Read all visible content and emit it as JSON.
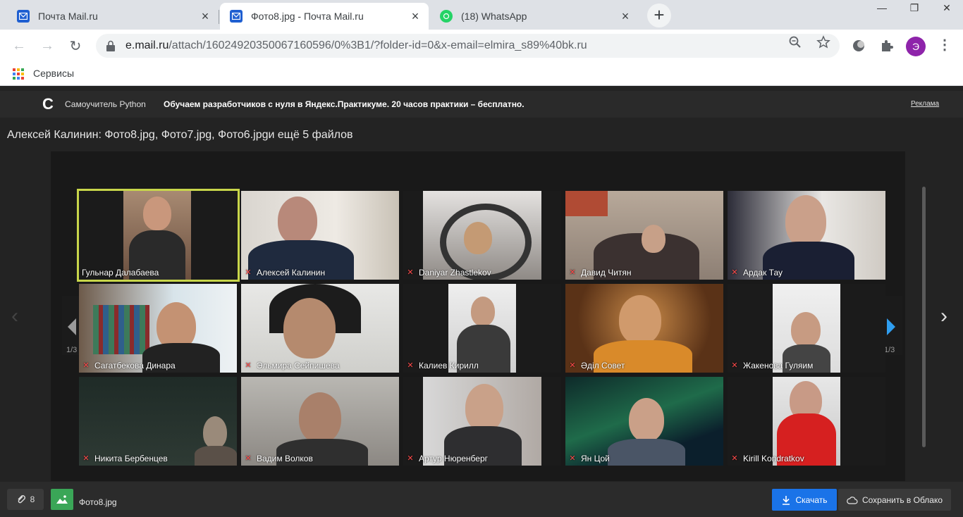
{
  "browser": {
    "tabs": [
      {
        "title": "Почта Mail.ru",
        "active": false
      },
      {
        "title": "Фото8.jpg - Почта Mail.ru",
        "active": true
      },
      {
        "title": "(18) WhatsApp",
        "active": false
      }
    ],
    "newtab_label": "+",
    "url_host": "e.mail.ru",
    "url_rest": "/attach/16024920350067160596/0%3B1/?folder-id=0&x-email=elmira_s89%40bk.ru",
    "profile_initial": "Э",
    "bookmarks_label": "Сервисы"
  },
  "ad": {
    "logo": "C",
    "title": "Самоучитель Python",
    "text": "Обучаем разработчиков с нуля в Яндекс.Практикуме. 20 часов практики – бесплатно.",
    "link": "Реклама"
  },
  "viewer": {
    "title": "Алексей Калинин: Фото8.jpg, Фото7.jpg, Фото6.jpgи ещё 5 файлов",
    "page_left": "1/3",
    "page_right": "1/3",
    "participants": [
      {
        "name": "Гульнар Далабаева",
        "muted": false,
        "speaker": true
      },
      {
        "name": "Алексей Калинин",
        "muted": true
      },
      {
        "name": "Daniyar Zhastlekov",
        "muted": true
      },
      {
        "name": "Давид Читян",
        "muted": true
      },
      {
        "name": "Ардак Тау",
        "muted": true
      },
      {
        "name": "Сагатбекова Динара",
        "muted": true
      },
      {
        "name": "Эльмира Сейпишева",
        "muted": true
      },
      {
        "name": "Калиев Кирилл",
        "muted": true
      },
      {
        "name": "Әділ Совет",
        "muted": true
      },
      {
        "name": "Жакенова Гуляим",
        "muted": true
      },
      {
        "name": "Никита Бербенцев",
        "muted": true
      },
      {
        "name": "Вадим Волков",
        "muted": true
      },
      {
        "name": "Артур Нюренберг",
        "muted": true
      },
      {
        "name": "Ян Цой",
        "muted": true
      },
      {
        "name": "Kirill Kondratkov",
        "muted": true
      }
    ]
  },
  "bottom": {
    "attach_count": "8",
    "filename": "Фото8.jpg",
    "download_label": "Скачать",
    "cloud_label": "Сохранить в Облако"
  },
  "colors": {
    "accent_blue": "#1a73e8",
    "speaker_border": "#c8d64a",
    "mute_red": "#ff4b4b"
  }
}
